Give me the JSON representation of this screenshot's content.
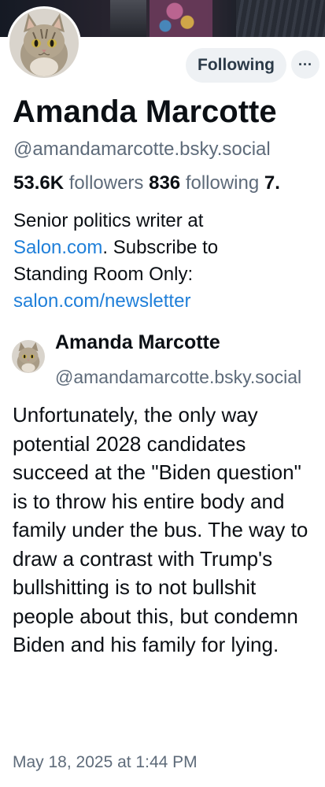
{
  "profile": {
    "display_name": "Amanda Marcotte",
    "handle": "@amandamarcotte.bsky.social",
    "followers_count": "53.6K",
    "followers_label": "followers",
    "following_count": "836",
    "following_label": "following",
    "posts_count_truncated": "7.",
    "follow_button_label": "Following",
    "more_button_label": "···",
    "avatar": "cat-avatar",
    "bio": {
      "line1": "Senior politics writer at",
      "link1": "Salon.com",
      "line2_after_link": ". Subscribe to",
      "line3": "Standing Room Only:",
      "link2": "salon.com/newsletter"
    }
  },
  "post": {
    "author_name": "Amanda Marcotte",
    "author_handle": "@amandamarcotte.bsky.social",
    "text": "Unfortunately, the only way potential 2028 candidates succeed at the \"Biden question\" is to throw his entire body and family under the bus. The way to draw a contrast with Trump's bullshitting is to not bullshit people about this, but condemn Biden and his family for lying.",
    "timestamp": "May 18, 2025 at 1:44 PM"
  },
  "colors": {
    "link": "#1f7fd9",
    "muted_text": "#5e6b7a",
    "button_bg": "#eef1f4"
  }
}
